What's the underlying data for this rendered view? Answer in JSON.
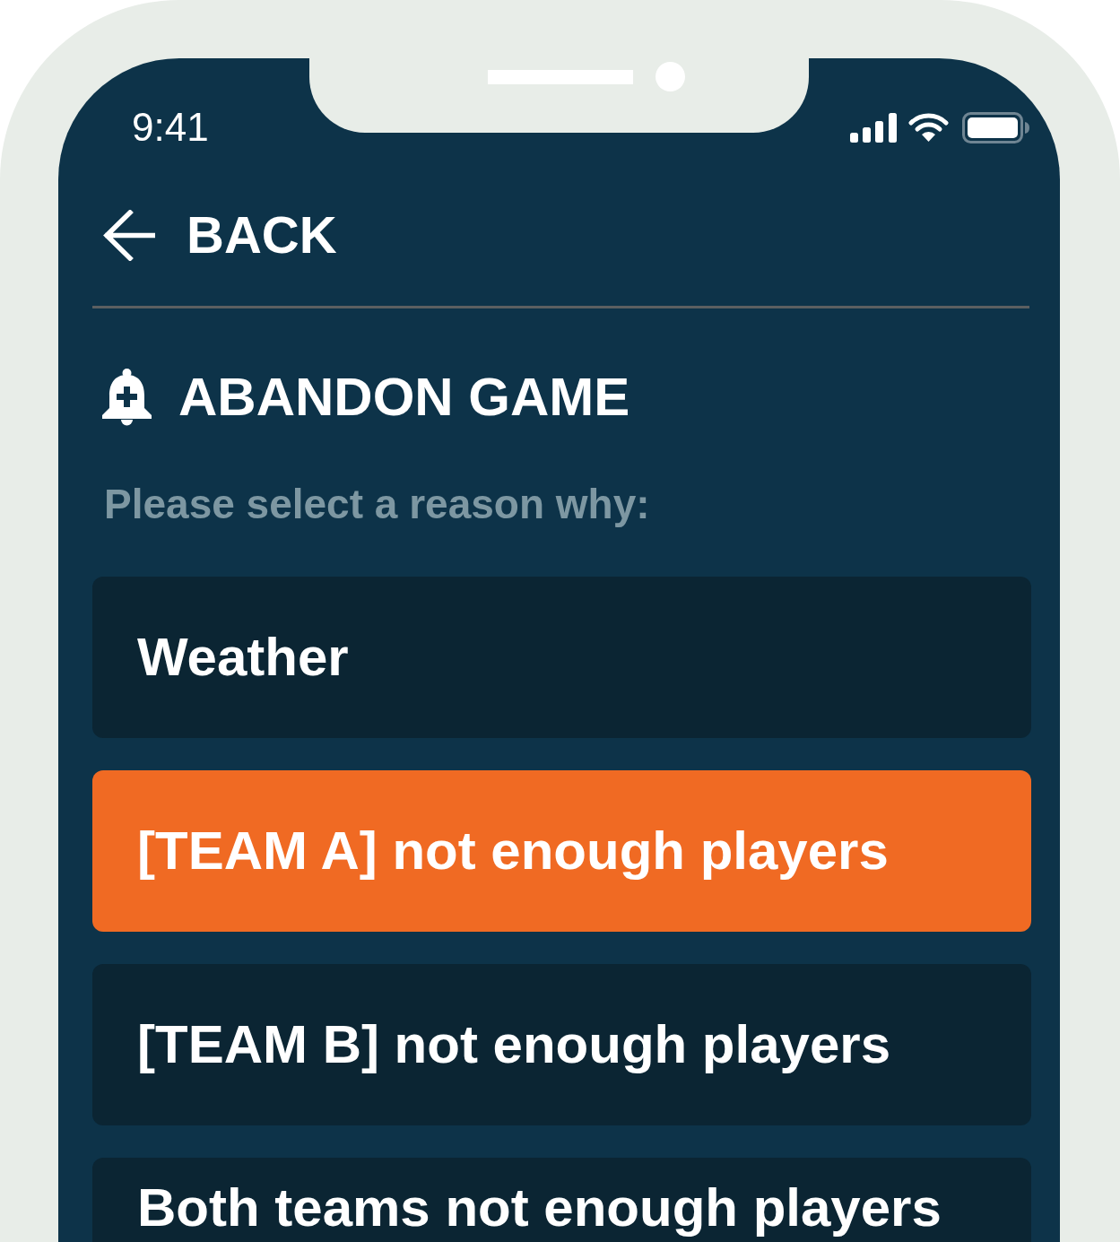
{
  "status_bar": {
    "time": "9:41"
  },
  "header": {
    "back_label": "BACK"
  },
  "title": "ABANDON GAME",
  "prompt": "Please select a reason why:",
  "reasons": [
    {
      "label": "Weather",
      "selected": false
    },
    {
      "label": "[TEAM A] not enough players",
      "selected": true
    },
    {
      "label": "[TEAM B] not enough players",
      "selected": false
    },
    {
      "label": "Both teams not enough players",
      "selected": false
    }
  ]
}
